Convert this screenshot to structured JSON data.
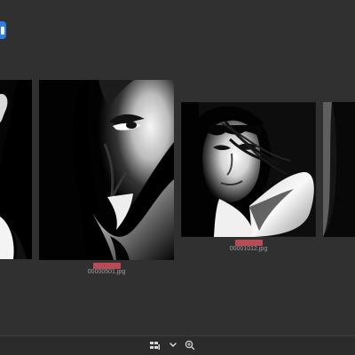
{
  "app": {
    "view": "image browser thumbnail strip"
  },
  "thumbnails": [
    {
      "name": "",
      "subject": "partial portrait",
      "selected": false
    },
    {
      "name": "00000501.jpg",
      "subject": "close-up face in shadow",
      "selected": true
    },
    {
      "name": "00001012.jpg",
      "subject": "woman with bangs in monochrome",
      "selected": true
    },
    {
      "name": "",
      "subject": "partial dark image",
      "selected": false
    }
  ],
  "toolbar": {
    "grid_icon": "thumbnail-grid-icon",
    "chevron_icon": "chevron-down-icon",
    "zoom_icon": "zoom-in-icon"
  },
  "colors": {
    "background": "#303030",
    "selection": "#b94b56",
    "accent": "#2f7de1",
    "filename": "#9d9d9d"
  }
}
